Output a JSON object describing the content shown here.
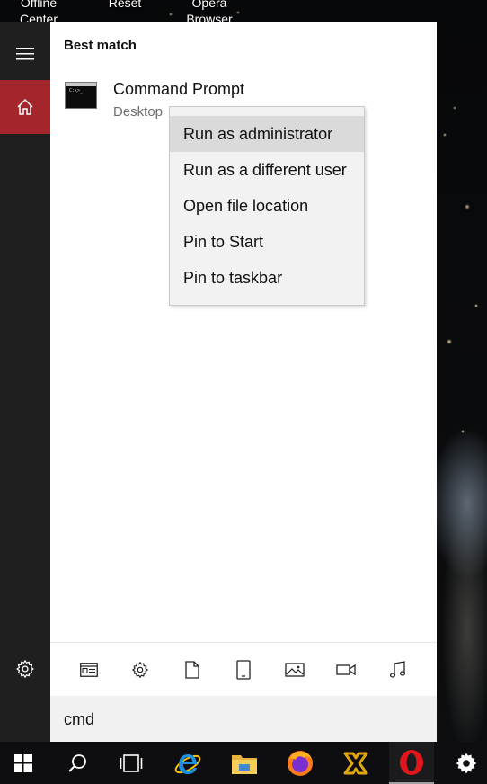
{
  "desktop": {
    "labels": [
      {
        "line1": "Offline",
        "line2": "Center"
      },
      {
        "line1": "Reset",
        "line2": ""
      },
      {
        "line1": "Opera",
        "line2": "Browser"
      }
    ]
  },
  "rail": {
    "menu_icon": "hamburger-icon",
    "home_icon": "home-icon",
    "settings_icon": "gear-icon"
  },
  "panel": {
    "section_title": "Best match",
    "result": {
      "title": "Command Prompt",
      "subtitle": "Desktop",
      "icon": "command-prompt-icon",
      "icon_text": "C:\\>_"
    }
  },
  "context_menu": {
    "items": [
      {
        "label": "Run as administrator",
        "highlighted": true
      },
      {
        "label": "Run as a different user",
        "highlighted": false
      },
      {
        "label": "Open file location",
        "highlighted": false
      },
      {
        "label": "Pin to Start",
        "highlighted": false
      },
      {
        "label": "Pin to taskbar",
        "highlighted": false
      }
    ]
  },
  "filters": [
    "apps-icon",
    "settings-icon",
    "documents-icon",
    "devices-icon",
    "photos-icon",
    "videos-icon",
    "music-icon"
  ],
  "search": {
    "value": "cmd"
  },
  "taskbar": {
    "items": [
      "windows-start-icon",
      "search-icon",
      "task-view-icon",
      "internet-explorer-icon",
      "file-explorer-icon",
      "firefox-icon",
      "vmware-icon",
      "opera-icon",
      "settings-icon"
    ],
    "accent": "#a4262c"
  }
}
